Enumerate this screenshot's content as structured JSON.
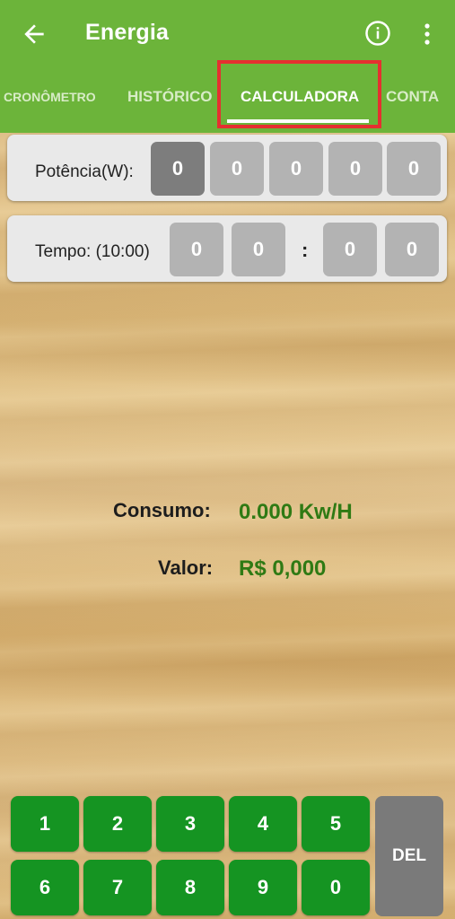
{
  "appbar": {
    "title": "Energia",
    "back_icon": "arrow-left-icon",
    "info_icon": "info-icon",
    "more_icon": "more-vert-icon"
  },
  "tabs": [
    {
      "label": "CRONÔMETRO"
    },
    {
      "label": "HISTÓRICO"
    },
    {
      "label": "CALCULADORA",
      "active": true
    },
    {
      "label": "CONTA"
    }
  ],
  "power": {
    "label": "Potência(W):",
    "digits": [
      "0",
      "0",
      "0",
      "0",
      "0"
    ],
    "selected_index": 0
  },
  "time": {
    "label": "Tempo: (10:00)",
    "digits": [
      "0",
      "0",
      "0",
      "0"
    ],
    "separator": ":"
  },
  "results": {
    "consumo_label": "Consumo:",
    "consumo_value": "0.000 Kw/H",
    "valor_label": "Valor:",
    "valor_value": "R$ 0,000"
  },
  "keypad": {
    "keys": [
      "1",
      "2",
      "3",
      "4",
      "5",
      "6",
      "7",
      "8",
      "9",
      "0"
    ],
    "del_label": "DEL"
  },
  "colors": {
    "primary": "#6cb43a",
    "key_green": "#159422",
    "value_green": "#2f7a14",
    "highlight_red": "#e53030"
  }
}
